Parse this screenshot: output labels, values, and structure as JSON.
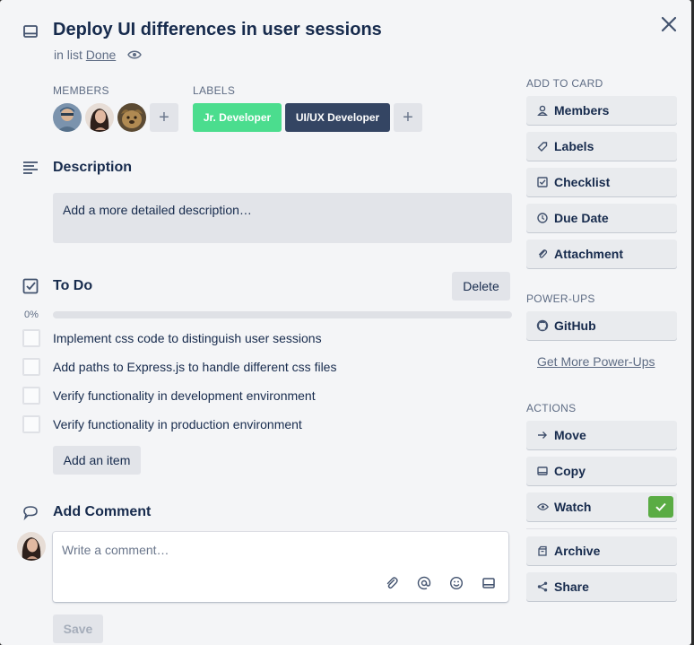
{
  "card": {
    "title": "Deploy UI differences in user sessions",
    "in_list_prefix": "in list",
    "list_name": "Done"
  },
  "members": {
    "heading": "MEMBERS",
    "avatars": [
      {
        "name": "member-1",
        "color": "#6f8fb0"
      },
      {
        "name": "member-2",
        "color": "#5a4a44"
      },
      {
        "name": "member-3",
        "color": "#9b7a4e"
      }
    ],
    "add_symbol": "+"
  },
  "labels": {
    "heading": "LABELS",
    "items": [
      {
        "text": "Jr. Developer",
        "color": "#4bdd8e"
      },
      {
        "text": "UI/UX Developer",
        "color": "#344563"
      }
    ],
    "add_symbol": "+"
  },
  "description": {
    "heading": "Description",
    "placeholder": "Add a more detailed description…"
  },
  "checklist": {
    "heading": "To Do",
    "delete_label": "Delete",
    "progress_text": "0%",
    "progress": 0,
    "items": [
      {
        "text": "Implement css code to distinguish user sessions",
        "checked": false
      },
      {
        "text": "Add paths to Express.js to handle different css files",
        "checked": false
      },
      {
        "text": "Verify functionality in development environment",
        "checked": false
      },
      {
        "text": "Verify functionality in production environment",
        "checked": false
      }
    ],
    "add_item_label": "Add an item"
  },
  "comment": {
    "heading": "Add Comment",
    "placeholder": "Write a comment…",
    "save_label": "Save"
  },
  "sidebar": {
    "add_to_card_heading": "ADD TO CARD",
    "add_to_card": [
      {
        "label": "Members",
        "icon": "person-icon"
      },
      {
        "label": "Labels",
        "icon": "tag-icon"
      },
      {
        "label": "Checklist",
        "icon": "checkbox-icon"
      },
      {
        "label": "Due Date",
        "icon": "clock-icon"
      },
      {
        "label": "Attachment",
        "icon": "paperclip-icon"
      }
    ],
    "power_ups_heading": "POWER-UPS",
    "power_ups": [
      {
        "label": "GitHub",
        "icon": "github-icon"
      }
    ],
    "get_more_label": "Get More Power-Ups",
    "actions_heading": "ACTIONS",
    "actions": [
      {
        "label": "Move",
        "icon": "arrow-right-icon"
      },
      {
        "label": "Copy",
        "icon": "card-icon"
      },
      {
        "label": "Watch",
        "icon": "eye-icon"
      },
      {
        "label": "Archive",
        "icon": "archive-icon"
      },
      {
        "label": "Share",
        "icon": "share-icon"
      }
    ]
  },
  "colors": {
    "accent_green": "#5aac44",
    "modal_bg": "#f4f5f7"
  }
}
